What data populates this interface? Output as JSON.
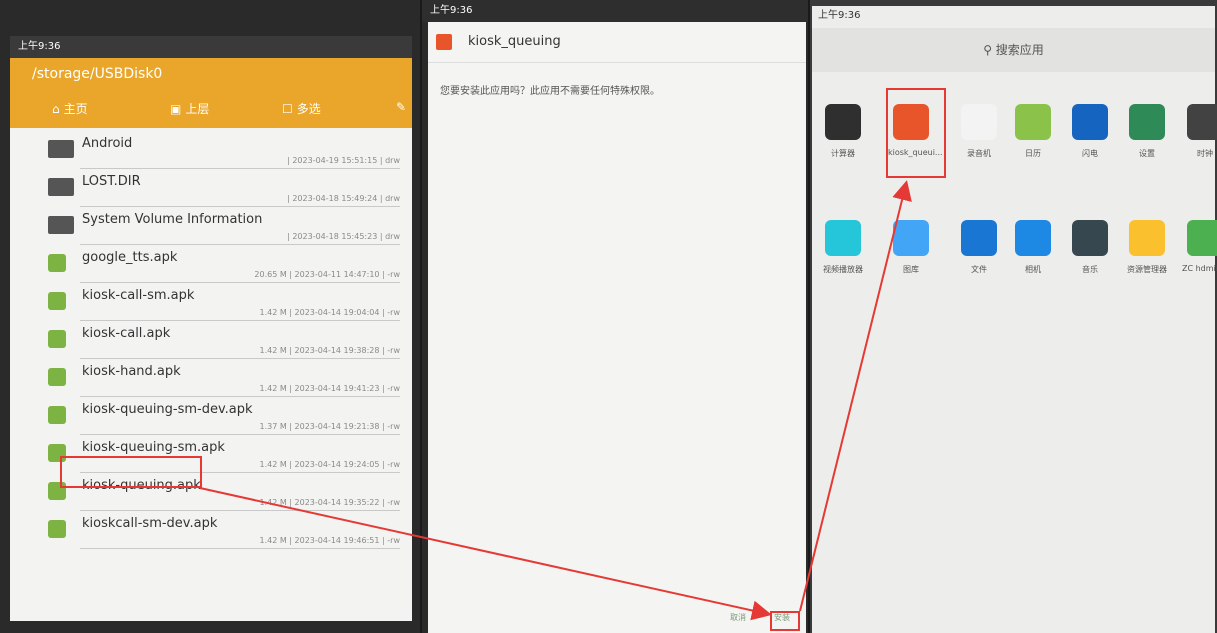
{
  "file_manager": {
    "status_time": "上午9:36",
    "path": "/storage/USBDisk0",
    "toolbar": {
      "home": "主页",
      "up": "上层",
      "multi": "多选"
    },
    "files": [
      {
        "name": "Android",
        "meta": "| 2023-04-19 15:51:15 | drw",
        "type": "folder"
      },
      {
        "name": "LOST.DIR",
        "meta": "| 2023-04-18 15:49:24 | drw",
        "type": "folder"
      },
      {
        "name": "System Volume Information",
        "meta": "| 2023-04-18 15:45:23 | drw",
        "type": "folder"
      },
      {
        "name": "google_tts.apk",
        "meta": "20.65 M | 2023-04-11 14:47:10 | -rw",
        "type": "apk"
      },
      {
        "name": "kiosk-call-sm.apk",
        "meta": "1.42 M | 2023-04-14 19:04:04 | -rw",
        "type": "apk"
      },
      {
        "name": "kiosk-call.apk",
        "meta": "1.42 M | 2023-04-14 19:38:28 | -rw",
        "type": "apk"
      },
      {
        "name": "kiosk-hand.apk",
        "meta": "1.42 M | 2023-04-14 19:41:23 | -rw",
        "type": "apk"
      },
      {
        "name": "kiosk-queuing-sm-dev.apk",
        "meta": "1.37 M | 2023-04-14 19:21:38 | -rw",
        "type": "apk"
      },
      {
        "name": "kiosk-queuing-sm.apk",
        "meta": "1.42 M | 2023-04-14 19:24:05 | -rw",
        "type": "apk"
      },
      {
        "name": "kiosk-queuing.apk",
        "meta": "1.42 M | 2023-04-14 19:35:22 | -rw",
        "type": "apk"
      },
      {
        "name": "kioskcall-sm-dev.apk",
        "meta": "1.42 M | 2023-04-14 19:46:51 | -rw",
        "type": "apk"
      }
    ]
  },
  "installer": {
    "status_time": "上午9:36",
    "app_name": "kiosk_queuing",
    "prompt": "您要安装此应用吗？此应用不需要任何特殊权限。",
    "cancel": "取消",
    "install": "安装"
  },
  "launcher": {
    "status_time": "上午9:36",
    "search_label": "搜索应用",
    "row1": [
      {
        "label": "计算器",
        "color": "#2f2f2f"
      },
      {
        "label": "kiosk_queui...",
        "color": "#e8552a"
      },
      {
        "label": "录音机",
        "color": "#f3f3f3"
      },
      {
        "label": "日历",
        "color": "#8bc34a"
      },
      {
        "label": "闪电",
        "color": "#1565c0"
      },
      {
        "label": "设置",
        "color": "#2e8b57"
      },
      {
        "label": "时钟",
        "color": "#424242"
      }
    ],
    "row2": [
      {
        "label": "视频播放器",
        "color": "#26c6da"
      },
      {
        "label": "图库",
        "color": "#42a5f5"
      },
      {
        "label": "文件",
        "color": "#1976d2"
      },
      {
        "label": "相机",
        "color": "#1e88e5"
      },
      {
        "label": "音乐",
        "color": "#37474f"
      },
      {
        "label": "资源管理器",
        "color": "#fbc02d"
      },
      {
        "label": "ZC hdmiin...",
        "color": "#4caf50"
      }
    ]
  },
  "annotation_color": "#e53935"
}
